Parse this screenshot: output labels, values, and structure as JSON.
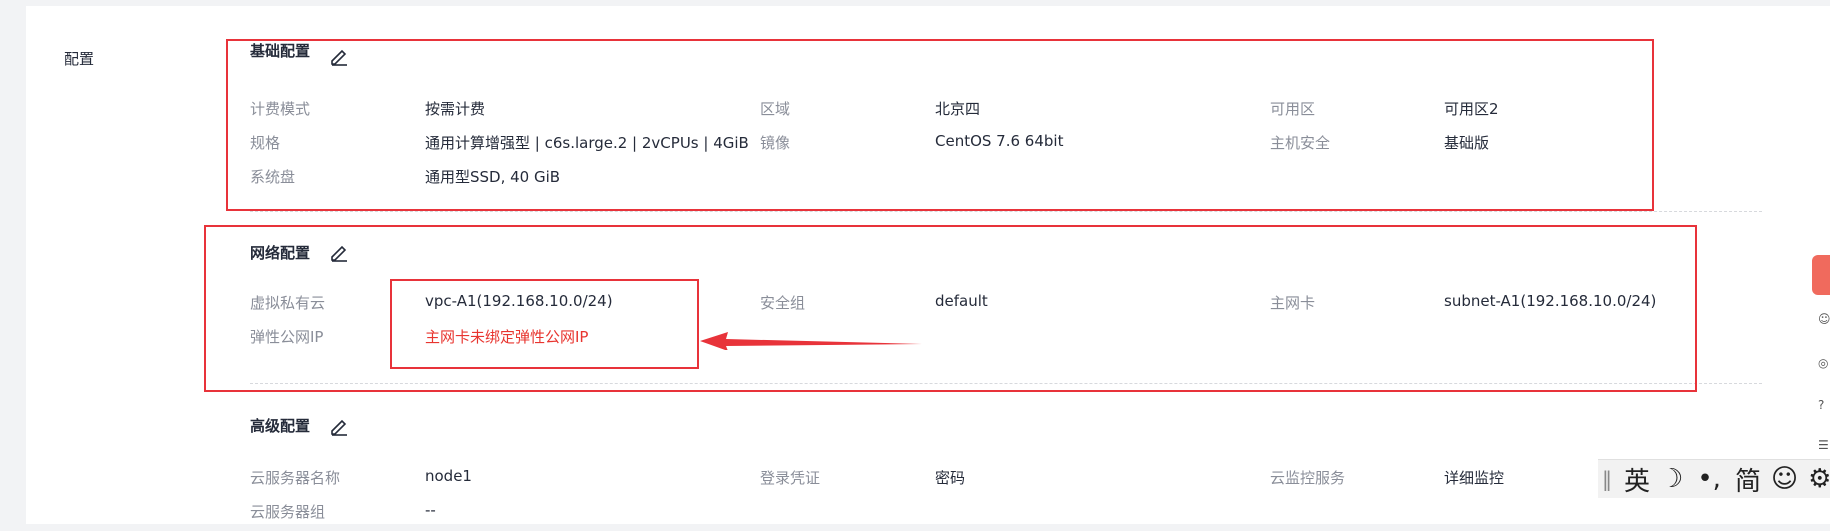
{
  "side_label": "配置",
  "basic": {
    "title": "基础配置",
    "rows": [
      [
        {
          "label": "计费模式",
          "value": "按需计费"
        },
        {
          "label": "区域",
          "value": "北京四"
        },
        {
          "label": "可用区",
          "value": "可用区2"
        }
      ],
      [
        {
          "label": "规格",
          "value": "通用计算增强型 | c6s.large.2 | 2vCPUs | 4GiB"
        },
        {
          "label": "镜像",
          "value": "CentOS 7.6 64bit"
        },
        {
          "label": "主机安全",
          "value": "基础版"
        }
      ],
      [
        {
          "label": "系统盘",
          "value": "通用型SSD, 40 GiB"
        }
      ]
    ]
  },
  "network": {
    "title": "网络配置",
    "rows": [
      [
        {
          "label": "虚拟私有云",
          "value": "vpc-A1(192.168.10.0/24)"
        },
        {
          "label": "安全组",
          "value": "default"
        },
        {
          "label": "主网卡",
          "value": "subnet-A1(192.168.10.0/24)"
        }
      ],
      [
        {
          "label": "弹性公网IP",
          "value": "主网卡未绑定弹性公网IP"
        }
      ]
    ]
  },
  "advanced": {
    "title": "高级配置",
    "rows": [
      [
        {
          "label": "云服务器名称",
          "value": "node1"
        },
        {
          "label": "登录凭证",
          "value": "密码"
        },
        {
          "label": "云监控服务",
          "value": "详细监控"
        }
      ],
      [
        {
          "label": "云服务器组",
          "value": "--"
        }
      ]
    ]
  },
  "ime_bar": {
    "separator": "‖",
    "lang": "英",
    "moon": "☽",
    "punct": "•,",
    "simplified": "简",
    "smile": "☺",
    "gear": "⚙"
  },
  "colors": {
    "highlight": "#e8333a",
    "warning_text": "#e8352f",
    "label_text": "#8a8e99"
  },
  "icons": [
    "edit-icon",
    "arrow-annotation",
    "ime-toolbar"
  ]
}
